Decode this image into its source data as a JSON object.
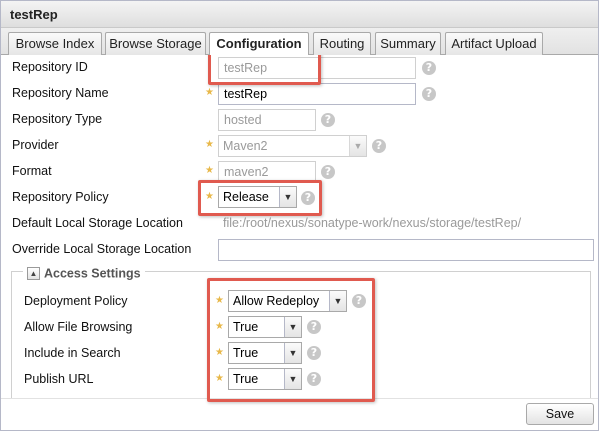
{
  "window": {
    "title": "testRep"
  },
  "tabs": [
    {
      "label": "Browse Index",
      "active": false
    },
    {
      "label": "Browse Storage",
      "active": false
    },
    {
      "label": "Configuration",
      "active": true
    },
    {
      "label": "Routing",
      "active": false
    },
    {
      "label": "Summary",
      "active": false
    },
    {
      "label": "Artifact Upload",
      "active": false
    }
  ],
  "form": {
    "repository_id": {
      "label": "Repository ID",
      "value": "testRep"
    },
    "repository_name": {
      "label": "Repository Name",
      "value": "testRep"
    },
    "repository_type": {
      "label": "Repository Type",
      "value": "hosted"
    },
    "provider": {
      "label": "Provider",
      "value": "Maven2"
    },
    "format": {
      "label": "Format",
      "value": "maven2"
    },
    "repository_policy": {
      "label": "Repository Policy",
      "value": "Release"
    },
    "default_storage": {
      "label": "Default Local Storage Location",
      "value": "file:/root/nexus/sonatype-work/nexus/storage/testRep/"
    },
    "override_storage": {
      "label": "Override Local Storage Location",
      "value": ""
    }
  },
  "access_settings": {
    "legend": "Access Settings",
    "deployment_policy": {
      "label": "Deployment Policy",
      "value": "Allow Redeploy"
    },
    "allow_file_browsing": {
      "label": "Allow File Browsing",
      "value": "True"
    },
    "include_in_search": {
      "label": "Include in Search",
      "value": "True"
    },
    "publish_url": {
      "label": "Publish URL",
      "value": "True"
    }
  },
  "footer": {
    "save_label": "Save"
  },
  "icons": {
    "required": "star-icon",
    "help": "help-icon",
    "dropdown": "chevron-down-icon",
    "collapse": "collapse-icon"
  },
  "colors": {
    "highlight": "#e05a4f",
    "required_star": "#e8b84a"
  }
}
